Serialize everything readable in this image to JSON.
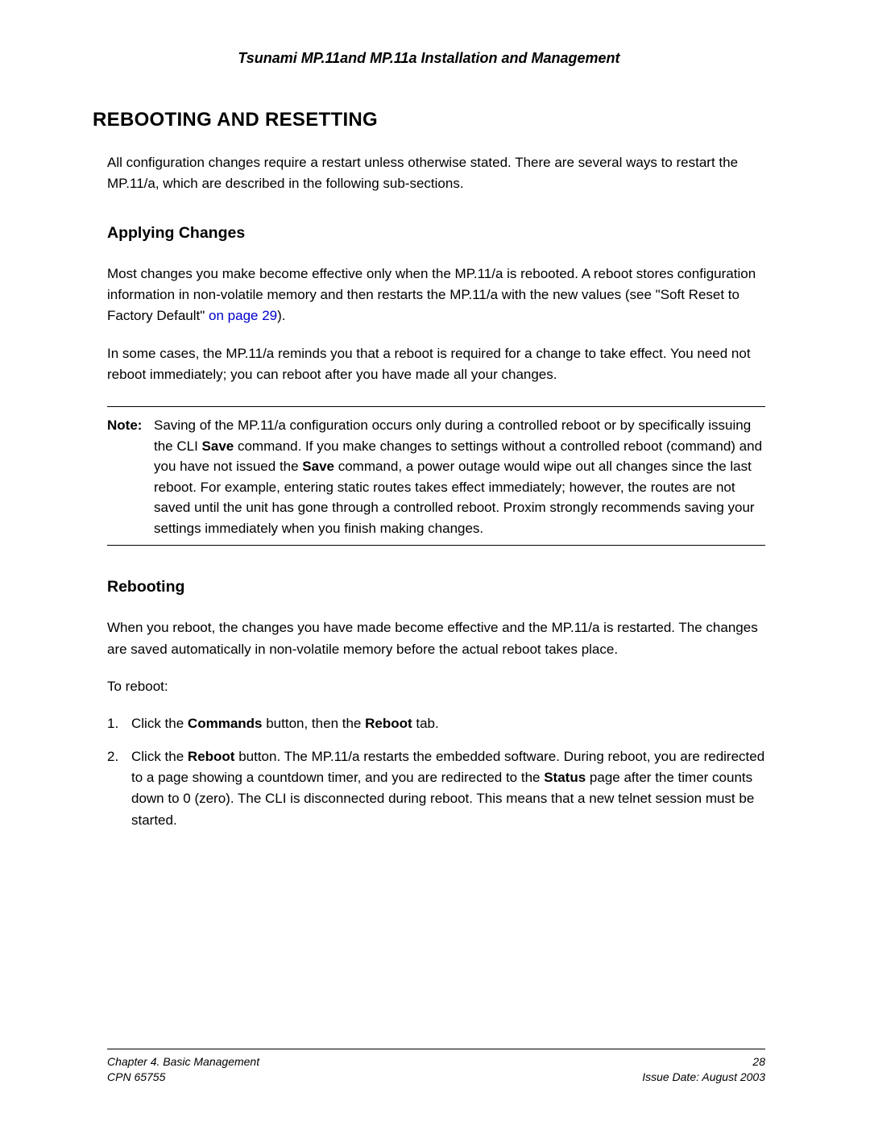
{
  "header": {
    "title": "Tsunami MP.11and MP.11a Installation and Management"
  },
  "main": {
    "heading": "REBOOTING AND RESETTING",
    "intro": "All configuration changes require a restart unless otherwise stated. There are several ways to restart the MP.11/a, which are described in the following sub-sections.",
    "section1": {
      "heading": "Applying Changes",
      "para1_a": "Most changes you make become effective only when the MP.11/a is rebooted.  A reboot stores configuration information in non-volatile memory and then restarts the MP.11/a with the new values (see \"Soft Reset to Factory Default\" ",
      "para1_link": "on page 29",
      "para1_b": ").",
      "para2": "In some cases, the MP.11/a reminds you that a reboot is required for a change to take effect.  You need not reboot immediately; you can reboot after you have made all your changes."
    },
    "note": {
      "label": "Note:",
      "text_a": "Saving of the MP.11/a configuration occurs only during a controlled reboot or by specifically issuing the CLI ",
      "bold1": "Save",
      "text_b": " command.  If you make changes to settings without a controlled reboot (command) and you have not issued the ",
      "bold2": "Save",
      "text_c": " command, a power outage would wipe out all changes since the last reboot.  For example, entering static routes takes effect immediately; however, the routes are not saved until the unit has gone through a controlled reboot.  Proxim strongly recommends saving your settings immediately when you finish making changes."
    },
    "section2": {
      "heading": "Rebooting",
      "para1": "When you reboot, the changes you have made become effective and the MP.11/a is restarted.  The changes are saved automatically in non-volatile memory before the actual reboot takes place.",
      "para2": "To reboot:",
      "step1_num": "1.",
      "step1_a": "Click the ",
      "step1_b1": "Commands",
      "step1_b": " button, then the ",
      "step1_b2": "Reboot",
      "step1_c": " tab.",
      "step2_num": "2.",
      "step2_a": "Click the ",
      "step2_b1": "Reboot",
      "step2_b": " button.  The MP.11/a restarts the embedded software.  During reboot, you are redirected to a page showing a countdown timer, and you are redirected to the ",
      "step2_b2": "Status",
      "step2_c": " page after the timer counts down to 0 (zero).  The CLI is disconnected during reboot.  This means that a new telnet session must be started."
    }
  },
  "footer": {
    "left1": "Chapter 4.  Basic Management",
    "left2": "CPN 65755",
    "right1": "28",
    "right2": "Issue Date:  August 2003"
  }
}
